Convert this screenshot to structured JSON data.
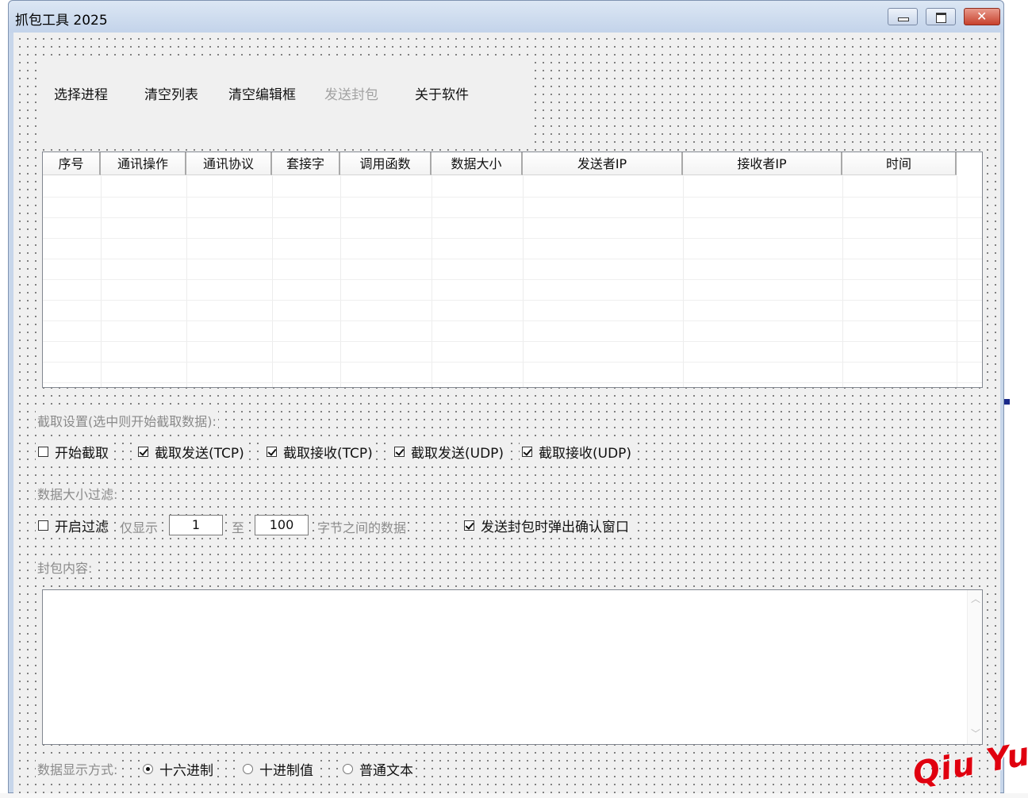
{
  "window": {
    "title": "抓包工具 2025"
  },
  "toolbar": {
    "items": [
      {
        "label": "选择进程",
        "enabled": true
      },
      {
        "label": "清空列表",
        "enabled": true
      },
      {
        "label": "清空编辑框",
        "enabled": true
      },
      {
        "label": "发送封包",
        "enabled": false
      },
      {
        "label": "关于软件",
        "enabled": true
      }
    ]
  },
  "list": {
    "columns": [
      "序号",
      "通讯操作",
      "通讯协议",
      "套接字",
      "调用函数",
      "数据大小",
      "发送者IP",
      "接收者IP",
      "时间"
    ],
    "rows": []
  },
  "capture": {
    "label": "截取设置(选中则开始截取数据):",
    "options": [
      {
        "label": "开始截取",
        "checked": false
      },
      {
        "label": "截取发送(TCP)",
        "checked": true
      },
      {
        "label": "截取接收(TCP)",
        "checked": true
      },
      {
        "label": "截取发送(UDP)",
        "checked": true
      },
      {
        "label": "截取接收(UDP)",
        "checked": true
      }
    ]
  },
  "filter": {
    "label": "数据大小过滤:",
    "enable_label": "开启过滤",
    "enabled": false,
    "only_show": "仅显示",
    "min": "1",
    "to": "至",
    "max": "100",
    "suffix": "字节之间的数据",
    "confirm_label": "发送封包时弹出确认窗口",
    "confirm_checked": true
  },
  "packet": {
    "label": "封包内容:",
    "content": ""
  },
  "display": {
    "label": "数据显示方式:",
    "options": [
      {
        "label": "十六进制",
        "selected": true
      },
      {
        "label": "十进制值",
        "selected": false
      },
      {
        "label": "普通文本",
        "selected": false
      }
    ]
  },
  "watermark": "Qiu Yue",
  "colors": {
    "titlebar": "#c3d3ea",
    "close_button": "#c7412c",
    "client_bg": "#f0f0f0",
    "watermark": "#e0000f"
  }
}
